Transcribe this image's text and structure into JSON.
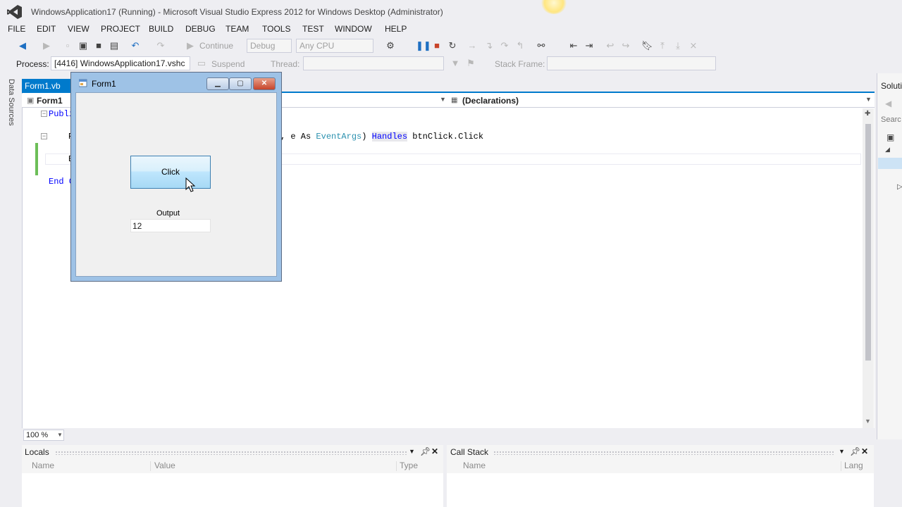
{
  "window": {
    "title": "WindowsApplication17 (Running) - Microsoft Visual Studio Express 2012 for Windows Desktop (Administrator)"
  },
  "menu": [
    "FILE",
    "EDIT",
    "VIEW",
    "PROJECT",
    "BUILD",
    "DEBUG",
    "TEAM",
    "TOOLS",
    "TEST",
    "WINDOW",
    "HELP"
  ],
  "toolbar": {
    "continue_label": "Continue",
    "config": "Debug",
    "platform": "Any CPU"
  },
  "debug_location": {
    "process_label": "Process:",
    "process_value": "[4416] WindowsApplication17.vshc",
    "suspend_label": "Suspend",
    "thread_label": "Thread:",
    "stack_frame_label": "Stack Frame:"
  },
  "side_strip": {
    "data_sources": "Data Sources"
  },
  "document_tab": {
    "label": "Form1.vb"
  },
  "nav_bar": {
    "class_selector": "Form1",
    "member_selector": "(Declarations)"
  },
  "code": {
    "line1": "Publi",
    "line2_prefix": "P",
    "line2_params": ", e As ",
    "line2_type": "EventArgs",
    "line2_close": ") ",
    "line2_handles": "Handles",
    "line2_handler": " btnClick.Click",
    "line3": "E",
    "line4": "End C"
  },
  "editor": {
    "zoom": "100 %"
  },
  "solution_explorer": {
    "title": "Soluti",
    "search": "Searc"
  },
  "locals": {
    "title": "Locals",
    "columns": [
      "Name",
      "Value",
      "Type"
    ]
  },
  "call_stack": {
    "title": "Call Stack",
    "columns": [
      "Name",
      "Lang"
    ]
  },
  "form1": {
    "title": "Form1",
    "button_label": "Click",
    "output_label": "Output",
    "output_value": "12"
  },
  "colors": {
    "accent": "#007acc",
    "change_margin": "#6cbe58",
    "keyword": "#0000ff",
    "type": "#2b91af"
  },
  "icons": [
    "vs-logo-icon",
    "back-icon",
    "forward-icon",
    "new-project-icon",
    "open-icon",
    "save-icon",
    "save-all-icon",
    "undo-icon",
    "redo-icon",
    "start-icon",
    "break-all-icon",
    "stop-icon",
    "restart-icon",
    "step-icon",
    "bookmark-icon",
    "pin-icon",
    "close-icon"
  ]
}
